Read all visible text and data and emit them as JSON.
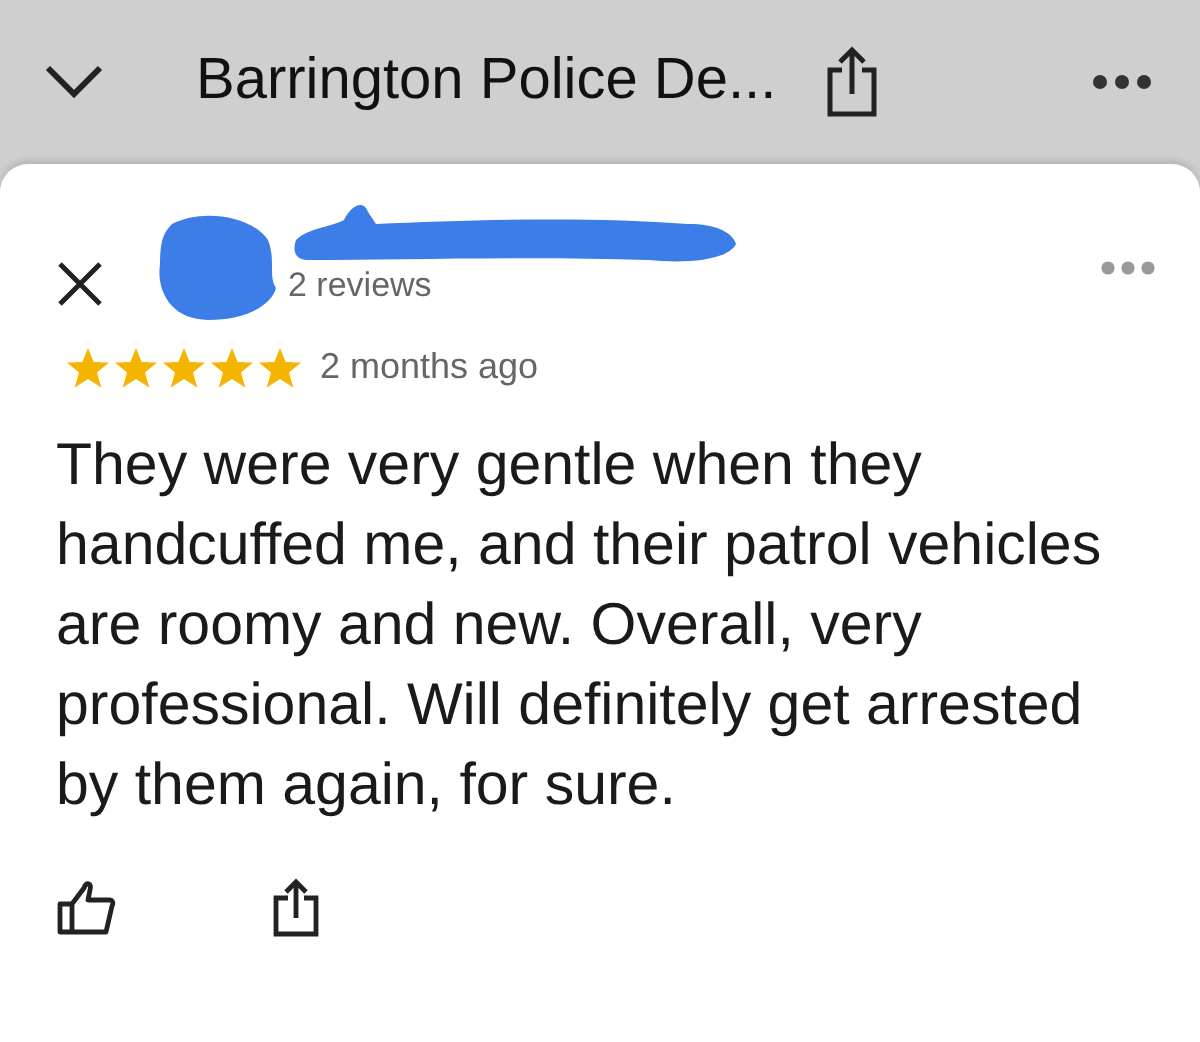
{
  "header": {
    "title": "Barrington Police De..."
  },
  "review": {
    "reviews_count": "2 reviews",
    "stars": 5,
    "time": "2 months ago",
    "text": "They were very gentle when they handcuffed me, and their patrol vehicles are roomy and new. Overall, very professional. Will definitely get arrested by them again, for sure."
  }
}
